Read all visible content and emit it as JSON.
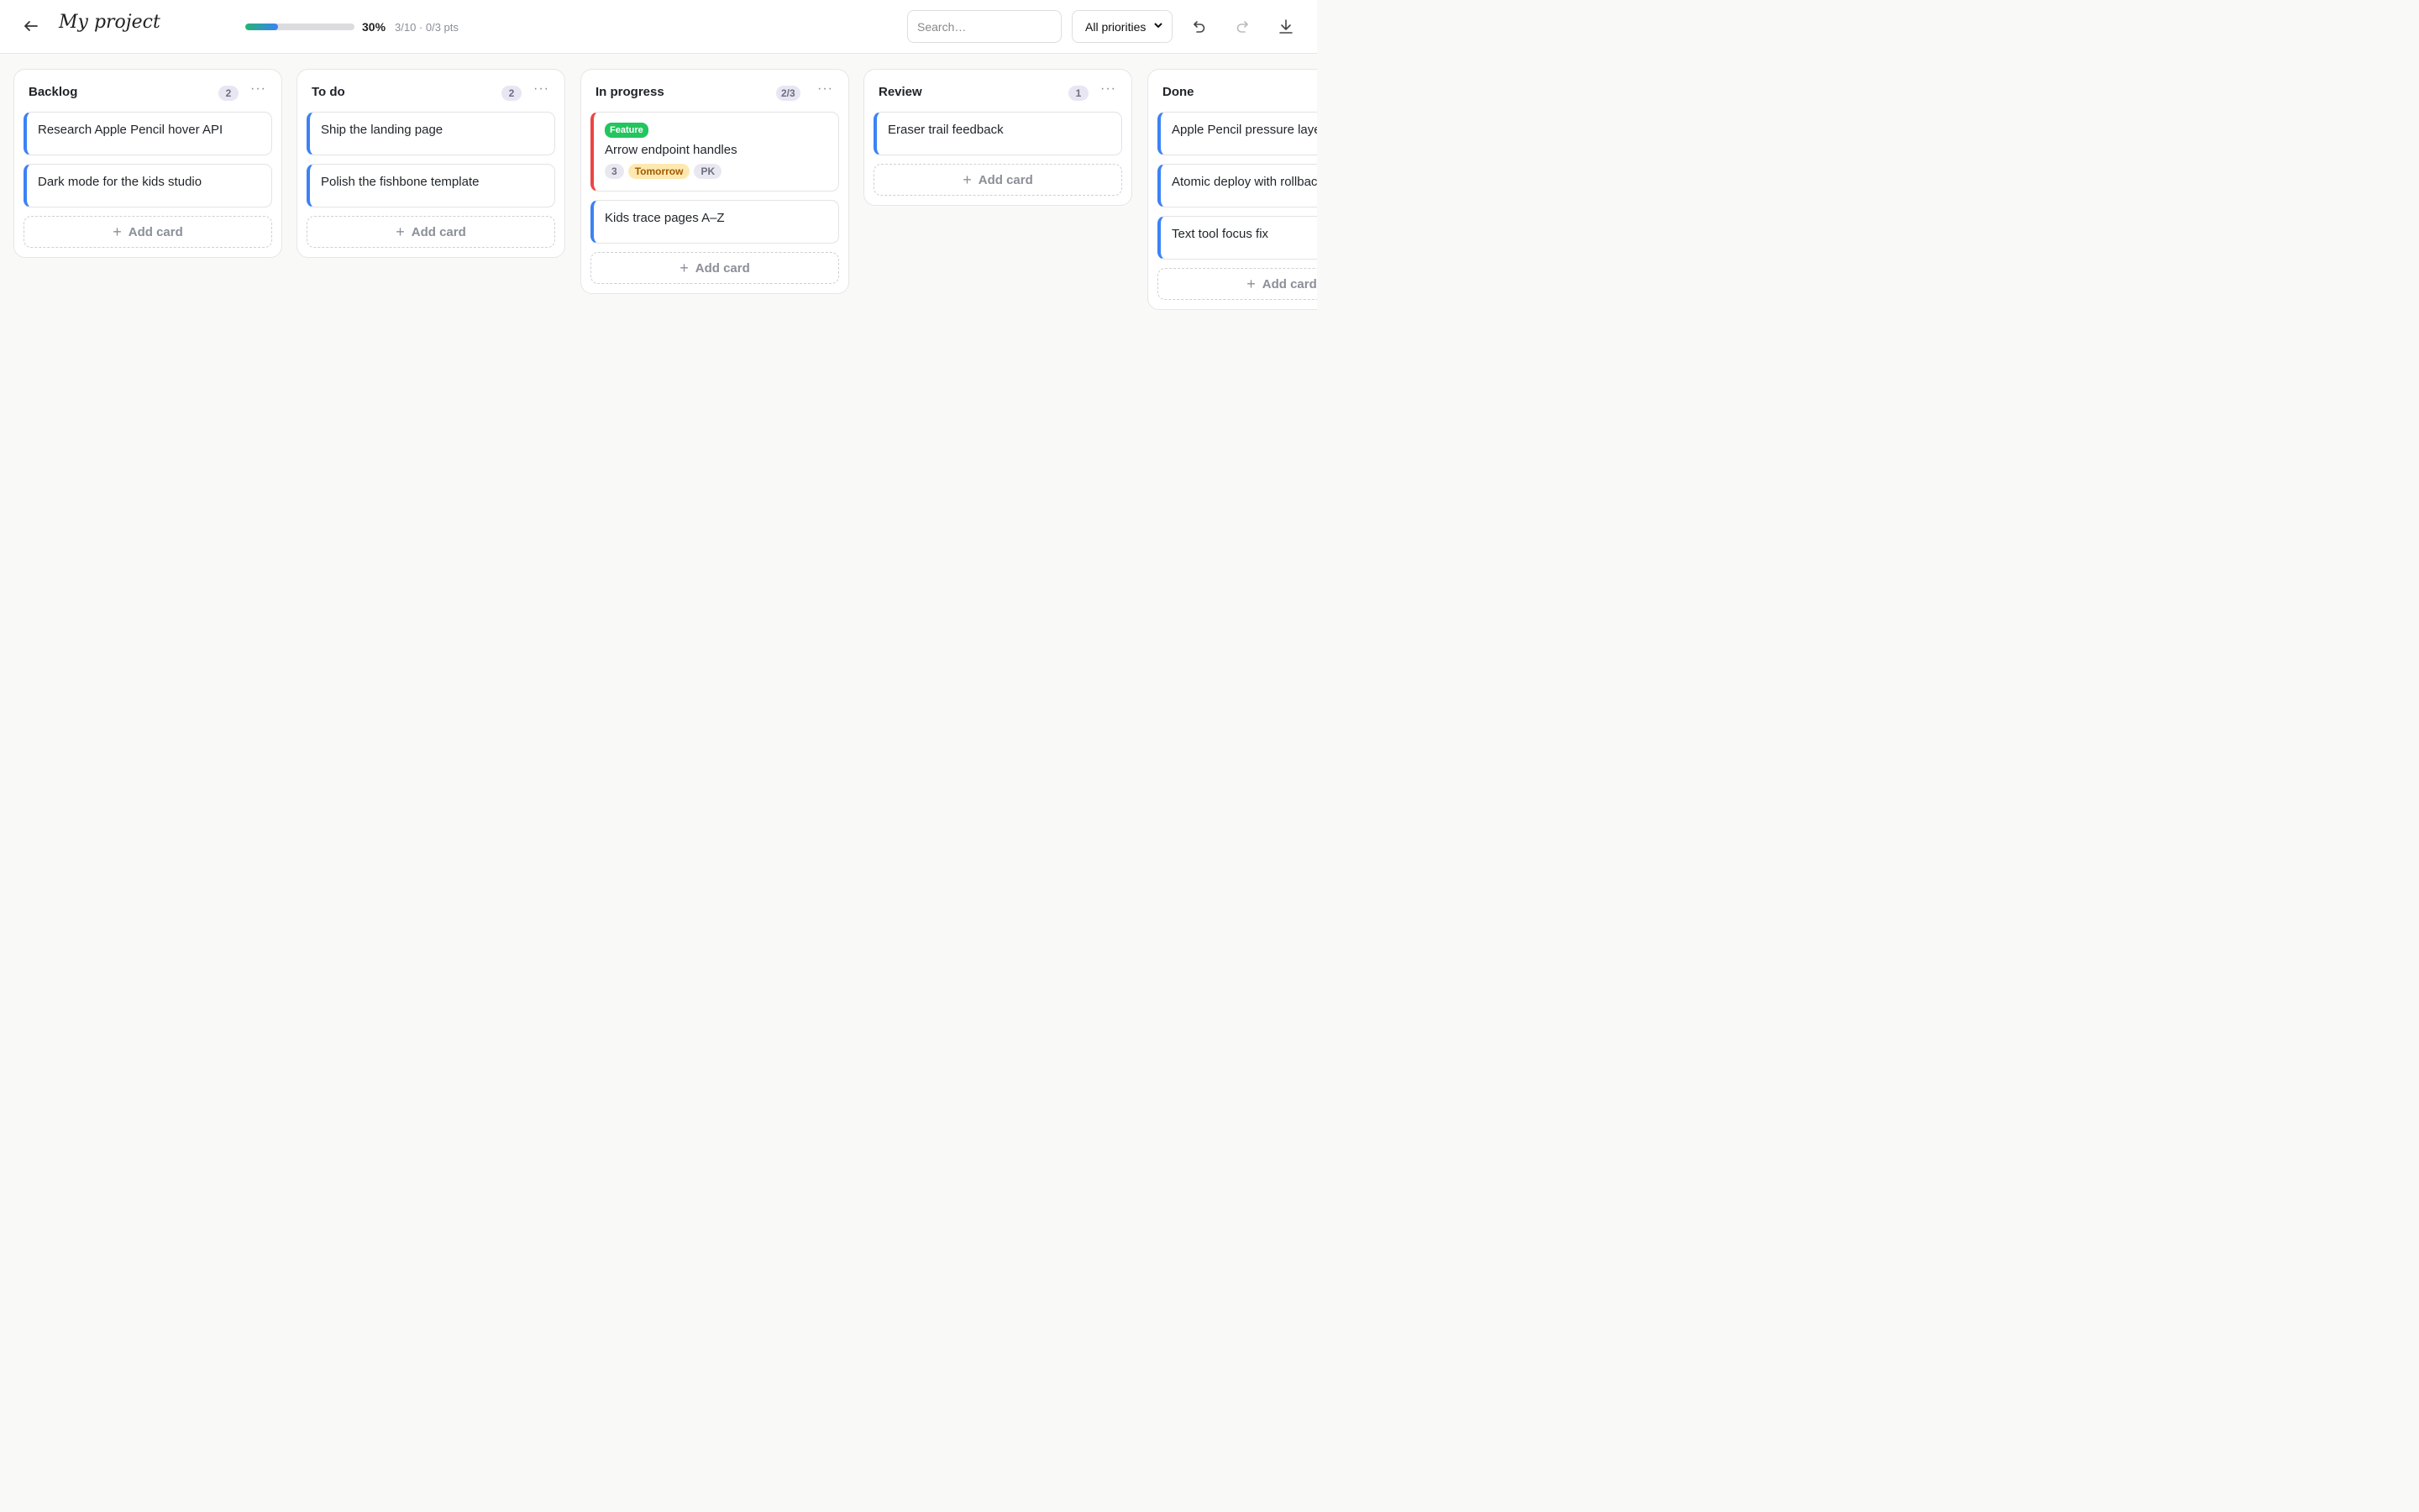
{
  "header": {
    "title": "My project",
    "progress_percent_value": 30,
    "progress_percent": "30%",
    "progress_meta": "3/10 · 0/3 pts",
    "search_placeholder": "Search…",
    "priority_filter": "All priorities",
    "icons": [
      "back-arrow-icon",
      "undo-icon",
      "redo-icon",
      "download-icon"
    ],
    "progress_gradient": [
      "#22b573",
      "#3b82f6"
    ]
  },
  "columns": [
    {
      "title": "Backlog",
      "count": "2",
      "cards": [
        {
          "title": "Research Apple Pencil hover API"
        },
        {
          "title": "Dark mode for the kids studio"
        }
      ],
      "add_label": "Add card"
    },
    {
      "title": "To do",
      "count": "2",
      "cards": [
        {
          "title": "Ship the landing page"
        },
        {
          "title": "Polish the fishbone template"
        }
      ],
      "add_label": "Add card"
    },
    {
      "title": "In progress",
      "count": "2/3",
      "cards": [
        {
          "title": "Arrow endpoint handles",
          "tag": "Feature",
          "points": "3",
          "due": "Tomorrow",
          "assignee": "PK"
        },
        {
          "title": "Kids trace pages A–Z"
        }
      ],
      "add_label": "Add card"
    },
    {
      "title": "Review",
      "count": "1",
      "cards": [
        {
          "title": "Eraser trail feedback"
        }
      ],
      "add_label": "Add card"
    },
    {
      "title": "Done",
      "count": "",
      "cards": [
        {
          "title": "Apple Pencil pressure layers"
        },
        {
          "title": "Atomic deploy with rollback"
        },
        {
          "title": "Text tool focus fix"
        }
      ],
      "add_label": "Add card"
    }
  ],
  "colors": {
    "accent_blue": "#3b82f6",
    "priority_red": "#ef4444",
    "tag_green": "#22c55e",
    "due_bg": "#fde9b0"
  }
}
